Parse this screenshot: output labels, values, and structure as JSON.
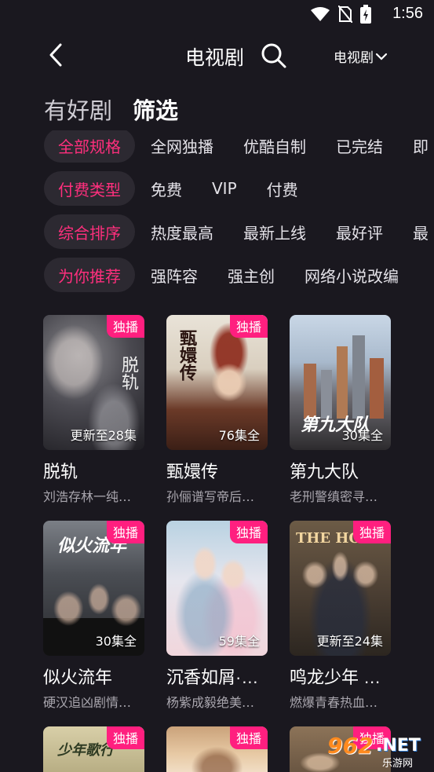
{
  "status": {
    "time": "1:56"
  },
  "header": {
    "title": "电视剧",
    "category_select": "电视剧"
  },
  "main_tabs": [
    {
      "label": "有好剧"
    },
    {
      "label": "筛选"
    }
  ],
  "filters": [
    {
      "active": "全部规格",
      "options": [
        "全网独播",
        "优酷自制",
        "已完结",
        "即"
      ]
    },
    {
      "active": "付费类型",
      "options": [
        "免费",
        "VIP",
        "付费"
      ]
    },
    {
      "active": "综合排序",
      "options": [
        "热度最高",
        "最新上线",
        "最好评",
        "最"
      ]
    },
    {
      "active": "为你推荐",
      "options": [
        "强阵容",
        "强主创",
        "网络小说改编"
      ]
    }
  ],
  "cards": [
    {
      "title": "脱轨",
      "subtitle": "刘浩存林一纯…",
      "badge": "独播",
      "episodes": "更新至28集",
      "poster_text": "脱轨"
    },
    {
      "title": "甄嬛传",
      "subtitle": "孙俪谱写帝后…",
      "badge": "独播",
      "episodes": "76集全",
      "poster_text": "甄嬛传"
    },
    {
      "title": "第九大队",
      "subtitle": "老刑警缜密寻…",
      "badge": "",
      "episodes": "30集全",
      "poster_text": "第九大队"
    },
    {
      "title": "似火流年",
      "subtitle": "硬汉追凶剧情…",
      "badge": "独播",
      "episodes": "30集全",
      "poster_text": "似火流年"
    },
    {
      "title": "沉香如屑·…",
      "subtitle": "杨紫成毅绝美…",
      "badge": "独播",
      "episodes": "59集全",
      "poster_text": ""
    },
    {
      "title": "鸣龙少年 …",
      "subtitle": "燃爆青春热血…",
      "badge": "独播",
      "episodes": "更新至24集",
      "poster_text": "THE HO"
    },
    {
      "title": "",
      "subtitle": "",
      "badge": "独播",
      "episodes": "",
      "poster_text": "少年歌行"
    },
    {
      "title": "",
      "subtitle": "",
      "badge": "独播",
      "episodes": "",
      "poster_text": ""
    },
    {
      "title": "",
      "subtitle": "",
      "badge": "独播",
      "episodes": "",
      "poster_text": ""
    }
  ],
  "watermark": {
    "num": "962",
    "net": ".NET",
    "sub": "乐游网"
  },
  "colors": {
    "background": "#1a181f",
    "accent": "#ff2f7d",
    "badge": "#ff1f7f",
    "chip_bg": "#2c2931"
  }
}
